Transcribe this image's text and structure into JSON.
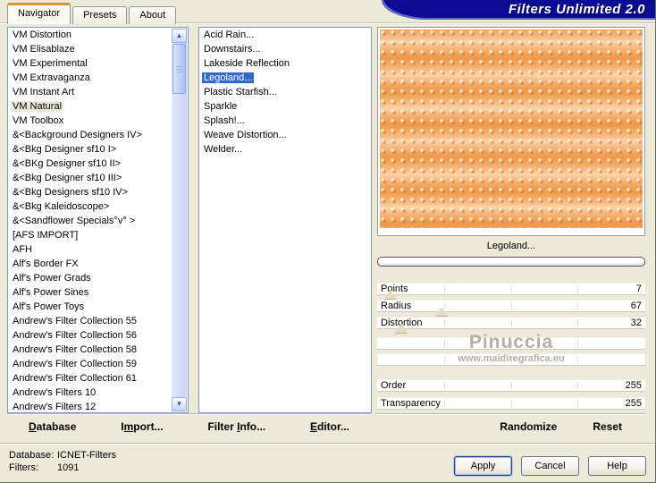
{
  "window": {
    "title": "Filters Unlimited 2.0"
  },
  "tabs": [
    {
      "label": "Navigator",
      "active": true
    },
    {
      "label": "Presets",
      "active": false
    },
    {
      "label": "About",
      "active": false
    }
  ],
  "category_list": {
    "selected": "VM Natural",
    "items": [
      "VM Distortion",
      "VM Elisablaze",
      "VM Experimental",
      "VM Extravaganza",
      "VM Instant Art",
      "VM Natural",
      "VM Toolbox",
      "&<Background Designers IV>",
      "&<Bkg Designer sf10 I>",
      "&<BKg Designer sf10 II>",
      "&<Bkg Designer sf10 III>",
      "&<Bkg Designers sf10 IV>",
      "&<Bkg Kaleidoscope>",
      "&<Sandflower Specials°v° >",
      "[AFS IMPORT]",
      "AFH",
      "Alf's Border FX",
      "Alf's Power Grads",
      "Alf's Power Sines",
      "Alf's Power Toys",
      "Andrew's Filter Collection 55",
      "Andrew's Filter Collection 56",
      "Andrew's Filter Collection 58",
      "Andrew's Filter Collection 59",
      "Andrew's Filter Collection 61",
      "Andrew's Filters 10",
      "Andrew's Filters 12"
    ]
  },
  "filter_list": {
    "selected": "Legoland...",
    "items": [
      "Acid Rain...",
      "Downstairs...",
      "Lakeside Reflection",
      "Legoland...",
      "Plastic Starfish...",
      "Sparkle",
      "Splash!...",
      "Weave Distortion...",
      "Welder..."
    ]
  },
  "preview": {
    "filter_name": "Legoland...",
    "pattern_base_color": "#f3aa60",
    "pattern_light_color": "#fbd4a6",
    "pattern_dark_color": "#ee9a4c"
  },
  "sliders": [
    {
      "label": "Points",
      "value": "7",
      "thumb_pct": 5
    },
    {
      "label": "Radius",
      "value": "67",
      "thumb_pct": 24
    },
    {
      "label": "Distortion",
      "value": "32",
      "thumb_pct": 9
    },
    {
      "label": "",
      "value": "",
      "thumb_pct": null
    },
    {
      "label": "",
      "value": "",
      "thumb_pct": null
    },
    {
      "label": "Order",
      "value": "255",
      "thumb_pct": null
    },
    {
      "label": "Transparency",
      "value": "255",
      "thumb_pct": null
    }
  ],
  "watermark": {
    "line1": "Pinuccia",
    "line2": "www.maidiregrafica.eu"
  },
  "command_bar": {
    "left_buttons": [
      {
        "text": "Database",
        "underline_index": 0
      },
      {
        "text": "Import...",
        "underline_index": 1
      },
      {
        "text": "Filter Info...",
        "underline_index": 7
      },
      {
        "text": "Editor...",
        "underline_index": 0
      }
    ],
    "randomize_label": "Randomize",
    "reset_label": "Reset"
  },
  "status": {
    "database_label": "Database:",
    "database_value": "ICNET-Filters",
    "filters_label": "Filters:",
    "filters_value": "1091"
  },
  "action_buttons": [
    {
      "label": "Apply",
      "default": true
    },
    {
      "label": "Cancel",
      "default": false
    },
    {
      "label": "Help",
      "default": false
    }
  ],
  "colors": {
    "dialog_bg": "#ece9d8",
    "banner_bg": "#0b0b93",
    "selection_blue": "#316ac5",
    "active_tab_accent": "#e0912d"
  }
}
